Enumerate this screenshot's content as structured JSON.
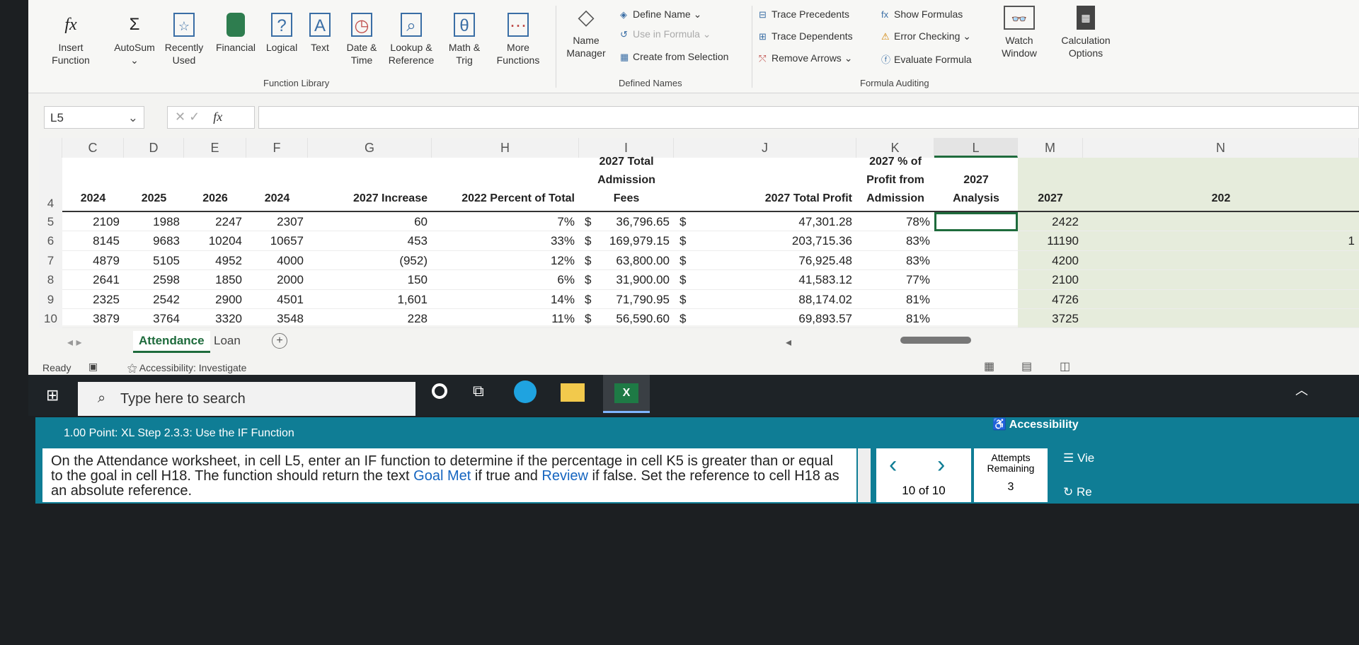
{
  "ribbon": {
    "buttons": [
      {
        "label": "Insert\nFunction",
        "icon": "fx-icon"
      },
      {
        "label": "AutoSum",
        "icon": "sigma-icon"
      },
      {
        "label": "Recently\nUsed",
        "icon": "star-icon"
      },
      {
        "label": "Financial",
        "icon": "financial-icon"
      },
      {
        "label": "Logical",
        "icon": "logical-icon"
      },
      {
        "label": "Text",
        "icon": "text-icon"
      },
      {
        "label": "Date &\nTime",
        "icon": "clock-icon"
      },
      {
        "label": "Lookup &\nReference",
        "icon": "lookup-icon"
      },
      {
        "label": "Math &\nTrig",
        "icon": "theta-icon"
      },
      {
        "label": "More\nFunctions",
        "icon": "more-icon"
      },
      {
        "label": "Name\nManager",
        "icon": "name-manager-icon"
      },
      {
        "label": "Watch\nWindow",
        "icon": "watch-icon"
      },
      {
        "label": "Calculation\nOptions",
        "icon": "calculator-icon"
      }
    ],
    "defined_names": [
      "Define Name",
      "Use in Formula",
      "Create from Selection"
    ],
    "auditing": [
      "Trace Precedents",
      "Trace Dependents",
      "Remove Arrows",
      "Show Formulas",
      "Error Checking",
      "Evaluate Formula"
    ],
    "groups": [
      "Function Library",
      "Defined Names",
      "Formula Auditing"
    ]
  },
  "formula_bar": {
    "name_box": "L5",
    "fx": "fx",
    "value": ""
  },
  "columns": [
    "C",
    "D",
    "E",
    "F",
    "G",
    "H",
    "I",
    "J",
    "K",
    "L",
    "M",
    "N"
  ],
  "headers": {
    "C": "2024",
    "D": "2025",
    "E": "2026",
    "F": "2024",
    "G": "2027 Increase",
    "H": "2022 Percent of Total",
    "I": [
      "2027 Total",
      "Admission",
      "Fees"
    ],
    "J": "2027 Total Profit",
    "K": [
      "2027 % of",
      "Profit from",
      "Admission"
    ],
    "L": [
      "2027",
      "Analysis"
    ],
    "M": "2027",
    "N": "202"
  },
  "rows": [
    {
      "n": "5",
      "C": "2109",
      "D": "1988",
      "E": "2247",
      "F": "2307",
      "G": "60",
      "H": "7%",
      "I": "36,796.65",
      "J": "47,301.28",
      "K": "78%",
      "L": "",
      "M": "2422",
      "N": ""
    },
    {
      "n": "6",
      "C": "8145",
      "D": "9683",
      "E": "10204",
      "F": "10657",
      "G": "453",
      "H": "33%",
      "I": "169,979.15",
      "J": "203,715.36",
      "K": "83%",
      "L": "",
      "M": "11190",
      "N": "1"
    },
    {
      "n": "7",
      "C": "4879",
      "D": "5105",
      "E": "4952",
      "F": "4000",
      "G": "(952)",
      "H": "12%",
      "I": "63,800.00",
      "J": "76,925.48",
      "K": "83%",
      "L": "",
      "M": "4200",
      "N": ""
    },
    {
      "n": "8",
      "C": "2641",
      "D": "2598",
      "E": "1850",
      "F": "2000",
      "G": "150",
      "H": "6%",
      "I": "31,900.00",
      "J": "41,583.12",
      "K": "77%",
      "L": "",
      "M": "2100",
      "N": ""
    },
    {
      "n": "9",
      "C": "2325",
      "D": "2542",
      "E": "2900",
      "F": "4501",
      "G": "1,601",
      "H": "14%",
      "I": "71,790.95",
      "J": "88,174.02",
      "K": "81%",
      "L": "",
      "M": "4726",
      "N": ""
    },
    {
      "n": "10",
      "C": "3879",
      "D": "3764",
      "E": "3320",
      "F": "3548",
      "G": "228",
      "H": "11%",
      "I": "56,590.60",
      "J": "69,893.57",
      "K": "81%",
      "L": "",
      "M": "3725",
      "N": ""
    }
  ],
  "header_row_num": "4",
  "currency": "$",
  "sheets": [
    "Attendance",
    "Loan"
  ],
  "active_sheet": "Attendance",
  "status": {
    "ready": "Ready",
    "accessibility": "Accessibility: Investigate"
  },
  "taskbar": {
    "search_placeholder": "Type here to search"
  },
  "assignment": {
    "step": "1.00 Point: XL Step 2.3.3: Use the IF Function",
    "accessibility": "Accessibility",
    "q1": "On the Attendance worksheet, in cell L5, enter an IF function to determine if the percentage in cell K5 is greater than or equal to the goal in cell H18. The function should return the text ",
    "kw1": "Goal Met",
    "q2": " if true and ",
    "kw2": "Review",
    "q3": " if false. Set the reference to cell H18 as an absolute reference.",
    "page": "10 of 10",
    "attempts_label": "Attempts Remaining",
    "attempts": "3",
    "view": "Vie",
    "reset": "Re"
  },
  "colors": {
    "accent": "#0f7d95",
    "excel_green": "#217346",
    "selection": "#1e6b3c"
  }
}
